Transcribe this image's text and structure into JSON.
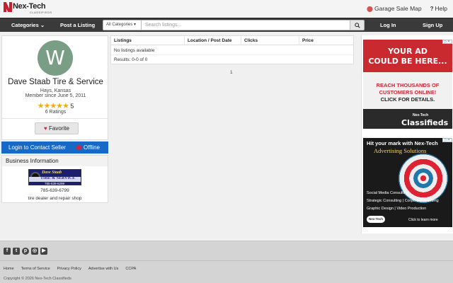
{
  "header": {
    "logo_name": "Nex-Tech",
    "logo_sub": "CLASSIFIEDS",
    "garage_sale_map": "Garage Sale Map",
    "help": "Help"
  },
  "nav": {
    "categories": "Categories",
    "post_listing": "Post a Listing",
    "search_category": "All Categories",
    "search_placeholder": "Search listings...",
    "login": "Log In",
    "signup": "Sign Up"
  },
  "profile": {
    "avatar_letter": "W",
    "name": "Dave Staab Tire & Service",
    "location": "Hays, Kansas",
    "member_since": "Member since June 5, 2011",
    "stars": "★★★★★",
    "rating": "5",
    "ratings_count": "6 Ratings",
    "favorite": "Favorite"
  },
  "contact": {
    "login_to_contact": "Login to Contact Seller",
    "status": "Offline"
  },
  "business": {
    "title": "Business Information",
    "logo_line1": "Dave Staab",
    "logo_line2": "TIRE & SERVICE",
    "logo_phone": "785-639-6299",
    "phone": "785-639-6799",
    "description": "tire dealer and repair shop"
  },
  "listings": {
    "columns": [
      "Listings",
      "Location / Post Date",
      "Clicks",
      "Price"
    ],
    "empty_message": "No listings available",
    "results": "Results: 0-0 of 0",
    "page": "1"
  },
  "ads": {
    "ad1_line1": "YOUR AD",
    "ad1_line2": "COULD BE HERE...",
    "ad1_mid1": "REACH THOUSANDS OF",
    "ad1_mid2": "CUSTOMERS ONLINE!",
    "ad1_mid3": "CLICK FOR DETAILS.",
    "ad1_brand_top": "Nex-Tech",
    "ad1_brand": "Classifieds",
    "ad2_head": "Hit your mark with Nex-Tech",
    "ad2_head2": "Advertising Solutions",
    "ad2_line1": "Social Media Consulting",
    "ad2_line2": "Strategic Consulting | Corporate Branding",
    "ad2_line3": "Graphic Design | Video Production",
    "ad2_logo": "Nex-Tech",
    "ad2_learn": "Click to learn more"
  },
  "footer": {
    "links": [
      "Home",
      "Terms of Service",
      "Privacy Policy",
      "Advertise with Us",
      "CCPA"
    ],
    "copyright": "Copyright © 2026 Nex-Tech Classifieds"
  },
  "colors": {
    "nav_bg": "#3a3a3a",
    "brand_red": "#c8202f",
    "contact_blue": "#1669c7",
    "avatar_green": "#7a9e85",
    "star_gold": "#f0ad1a"
  }
}
